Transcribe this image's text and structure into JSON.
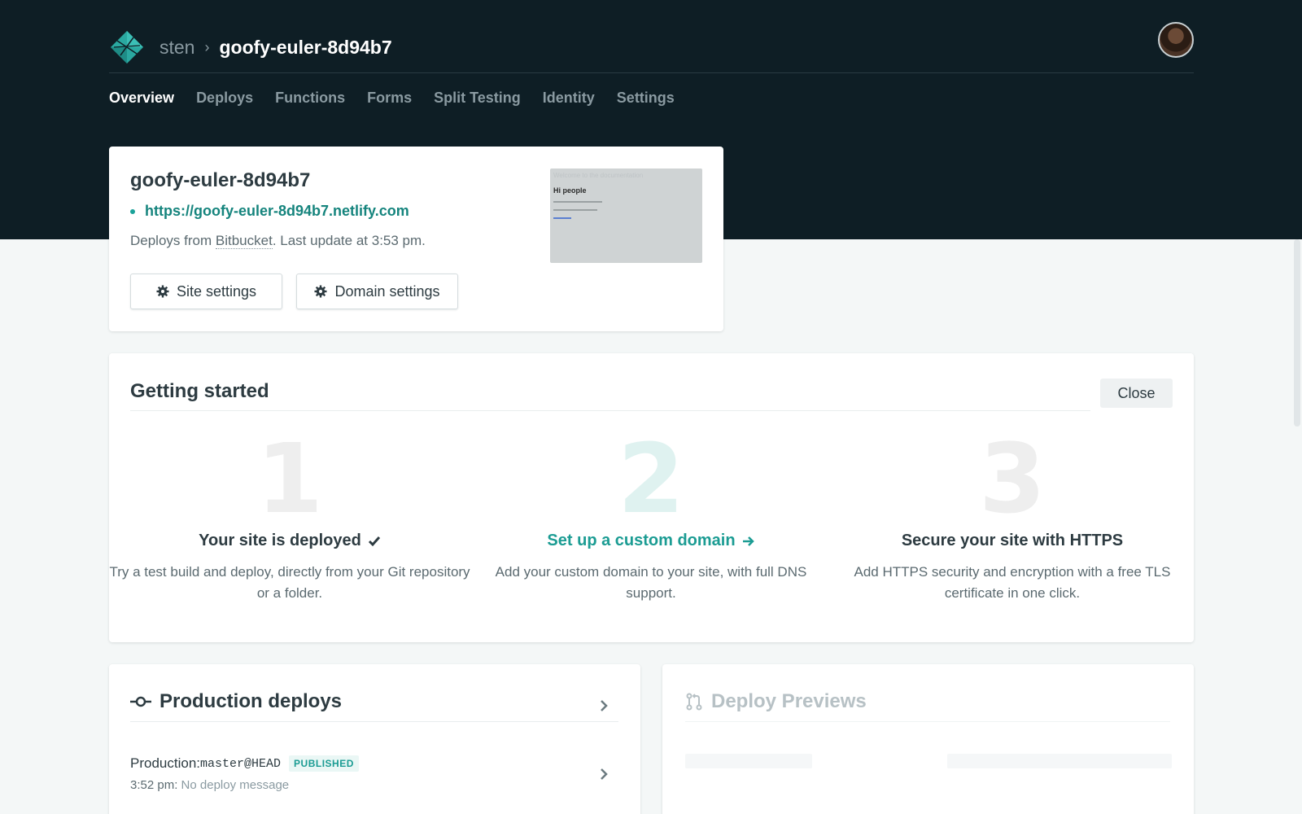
{
  "header": {
    "team": "sten",
    "separator": "›",
    "site_name": "goofy-euler-8d94b7"
  },
  "nav": {
    "items": [
      "Overview",
      "Deploys",
      "Functions",
      "Forms",
      "Split Testing",
      "Identity",
      "Settings"
    ],
    "active": "Overview"
  },
  "site_card": {
    "title": "goofy-euler-8d94b7",
    "url": "https://goofy-euler-8d94b7.netlify.com",
    "meta_prefix": "Deploys from ",
    "meta_provider": "Bitbucket",
    "meta_suffix": ". Last update at 3:53 pm.",
    "site_settings_label": "Site settings",
    "domain_settings_label": "Domain settings",
    "preview": {
      "heading": "Welcome to the documentation",
      "title": "Hi people"
    }
  },
  "getting_started": {
    "title": "Getting started",
    "close_label": "Close",
    "steps": [
      {
        "number": "1",
        "heading": "Your site is deployed",
        "icon": "check-icon",
        "description": "Try a test build and deploy, directly from your Git repository or a folder."
      },
      {
        "number": "2",
        "heading": "Set up a custom domain",
        "icon": "arrow-right-icon",
        "description": "Add your custom domain to your site, with full DNS support."
      },
      {
        "number": "3",
        "heading": "Secure your site with HTTPS",
        "icon": "",
        "description": "Add HTTPS security and encryption with a free TLS certificate in one click."
      }
    ]
  },
  "production": {
    "title": "Production deploys",
    "deploy": {
      "label": "Production: ",
      "ref": "master@HEAD",
      "status": "PUBLISHED",
      "time": "3:52 pm: ",
      "message": "No deploy message"
    }
  },
  "previews": {
    "title": "Deploy Previews"
  },
  "colors": {
    "accent": "#1b9c93",
    "header_bg": "#0e1e25",
    "page_bg": "#f4f7f7"
  }
}
